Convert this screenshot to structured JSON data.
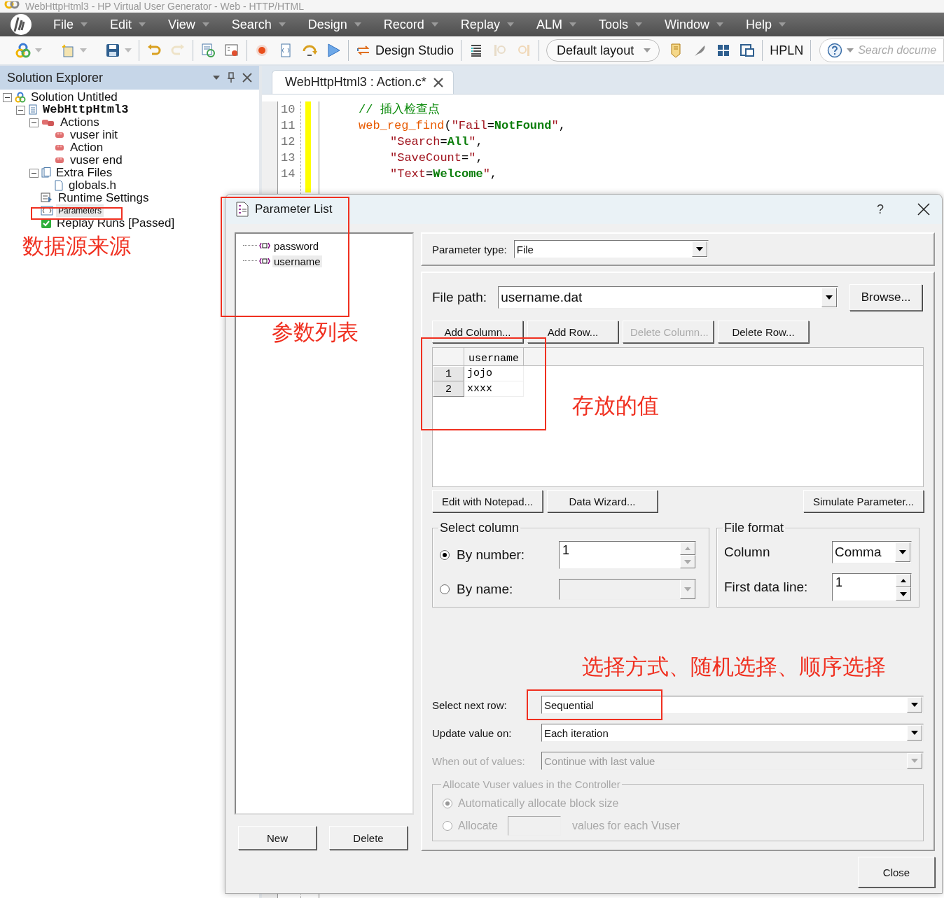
{
  "window": {
    "title": "WebHttpHtml3 - HP Virtual User Generator - Web - HTTP/HTML"
  },
  "menu": [
    "File",
    "Edit",
    "View",
    "Search",
    "Design",
    "Record",
    "Replay",
    "ALM",
    "Tools",
    "Window",
    "Help"
  ],
  "toolbar": {
    "design_studio": "Design Studio",
    "layout": "Default layout",
    "hpln": "HPLN",
    "search_placeholder": "Search docume"
  },
  "solution_explorer": {
    "title": "Solution Explorer",
    "tree": [
      {
        "label": "Solution Untitled",
        "kind": "solution",
        "expanded": true,
        "selected": false,
        "children": [
          {
            "label": "WebHttpHtml3",
            "kind": "script",
            "expanded": true,
            "selected": false,
            "children": [
              {
                "label": "Actions",
                "kind": "actions",
                "expanded": true,
                "selected": false,
                "children": [
                  {
                    "label": "vuser init",
                    "kind": "action",
                    "selected": false
                  },
                  {
                    "label": "Action",
                    "kind": "action",
                    "selected": false
                  },
                  {
                    "label": "vuser end",
                    "kind": "action",
                    "selected": false
                  }
                ]
              },
              {
                "label": "Extra Files",
                "kind": "files",
                "expanded": true,
                "selected": false,
                "children": [
                  {
                    "label": "globals.h",
                    "kind": "file",
                    "selected": false
                  }
                ]
              },
              {
                "label": "Runtime Settings",
                "kind": "settings",
                "selected": false
              },
              {
                "label": "Parameters",
                "kind": "parameters",
                "selected": true
              },
              {
                "label": "Replay Runs [Passed]",
                "kind": "passed",
                "selected": false
              }
            ]
          }
        ]
      }
    ]
  },
  "editor": {
    "tab": "WebHttpHtml3 : Action.c*",
    "lines": [
      {
        "number": "10",
        "indented": false,
        "tokens": [
          {
            "kind": "comment",
            "text": "// 插入检查点"
          }
        ]
      },
      {
        "number": "11",
        "indented": false,
        "tokens": [
          {
            "kind": "function",
            "text": "web_reg_find"
          },
          {
            "kind": "punct",
            "text": "("
          },
          {
            "kind": "string",
            "text": "\"Fail"
          },
          {
            "kind": "punct",
            "text": "="
          },
          {
            "kind": "value",
            "text": "NotFound"
          },
          {
            "kind": "string",
            "text": "\""
          },
          {
            "kind": "punct",
            "text": ","
          }
        ]
      },
      {
        "number": "12",
        "indented": true,
        "tokens": [
          {
            "kind": "string",
            "text": "\"Search"
          },
          {
            "kind": "punct",
            "text": "="
          },
          {
            "kind": "value",
            "text": "All"
          },
          {
            "kind": "string",
            "text": "\""
          },
          {
            "kind": "punct",
            "text": ","
          }
        ]
      },
      {
        "number": "13",
        "indented": true,
        "tokens": [
          {
            "kind": "string",
            "text": "\"SaveCount"
          },
          {
            "kind": "punct",
            "text": "="
          },
          {
            "kind": "string",
            "text": "\""
          },
          {
            "kind": "punct",
            "text": ","
          }
        ]
      },
      {
        "number": "14",
        "indented": true,
        "tokens": [
          {
            "kind": "string",
            "text": "\"Text"
          },
          {
            "kind": "punct",
            "text": "="
          },
          {
            "kind": "value",
            "text": "Welcome"
          },
          {
            "kind": "string",
            "text": "\""
          },
          {
            "kind": "punct",
            "text": ","
          }
        ]
      }
    ]
  },
  "dialog": {
    "title": "Parameter List",
    "help": "?",
    "parameters": [
      {
        "name": "password",
        "selected": false
      },
      {
        "name": "username",
        "selected": true
      }
    ],
    "list_buttons": [
      "New",
      "Delete"
    ],
    "parameter_type": {
      "label": "Parameter type:",
      "value": "File"
    },
    "file_path": {
      "label": "File path:",
      "value": "username.dat",
      "browse": "Browse..."
    },
    "table_buttons": [
      {
        "label": "Add Column...",
        "disabled": false
      },
      {
        "label": "Add Row...",
        "disabled": false
      },
      {
        "label": "Delete Column...",
        "disabled": true
      },
      {
        "label": "Delete Row...",
        "disabled": false
      }
    ],
    "table": {
      "columns": [
        "username"
      ],
      "rows": [
        {
          "number": "1",
          "cells": [
            "jojo"
          ]
        },
        {
          "number": "2",
          "cells": [
            "xxxx"
          ]
        }
      ]
    },
    "tool_buttons": [
      "Edit with Notepad...",
      "Data Wizard...",
      "Simulate Parameter..."
    ],
    "select_column": {
      "title": "Select column",
      "options": [
        {
          "label": "By number:",
          "selected": true,
          "value": "1",
          "disabled": false
        },
        {
          "label": "By name:",
          "selected": false,
          "disabled": true
        }
      ]
    },
    "file_format": {
      "title": "File format",
      "column_label": "Column",
      "column_value": "Comma",
      "first_line_label": "First data line:",
      "first_line_value": "1"
    },
    "row_settings": [
      {
        "label": "Select next row:",
        "value": "Sequential",
        "disabled": false
      },
      {
        "label": "Update value on:",
        "value": "Each iteration",
        "disabled": false
      },
      {
        "label": "When out of values:",
        "value": "Continue with last value",
        "disabled": true
      }
    ],
    "allocate": {
      "title": "Allocate Vuser values in the Controller",
      "disabled": true,
      "auto_label": "Automatically allocate block size",
      "auto_selected": true,
      "manual_label": "Allocate",
      "manual_selected": false,
      "manual_suffix": "values for each Vuser"
    },
    "close": "Close"
  },
  "annotations": [
    "数据源来源",
    "参数列表",
    "存放的值",
    "选择方式、随机选择、顺序选择"
  ]
}
